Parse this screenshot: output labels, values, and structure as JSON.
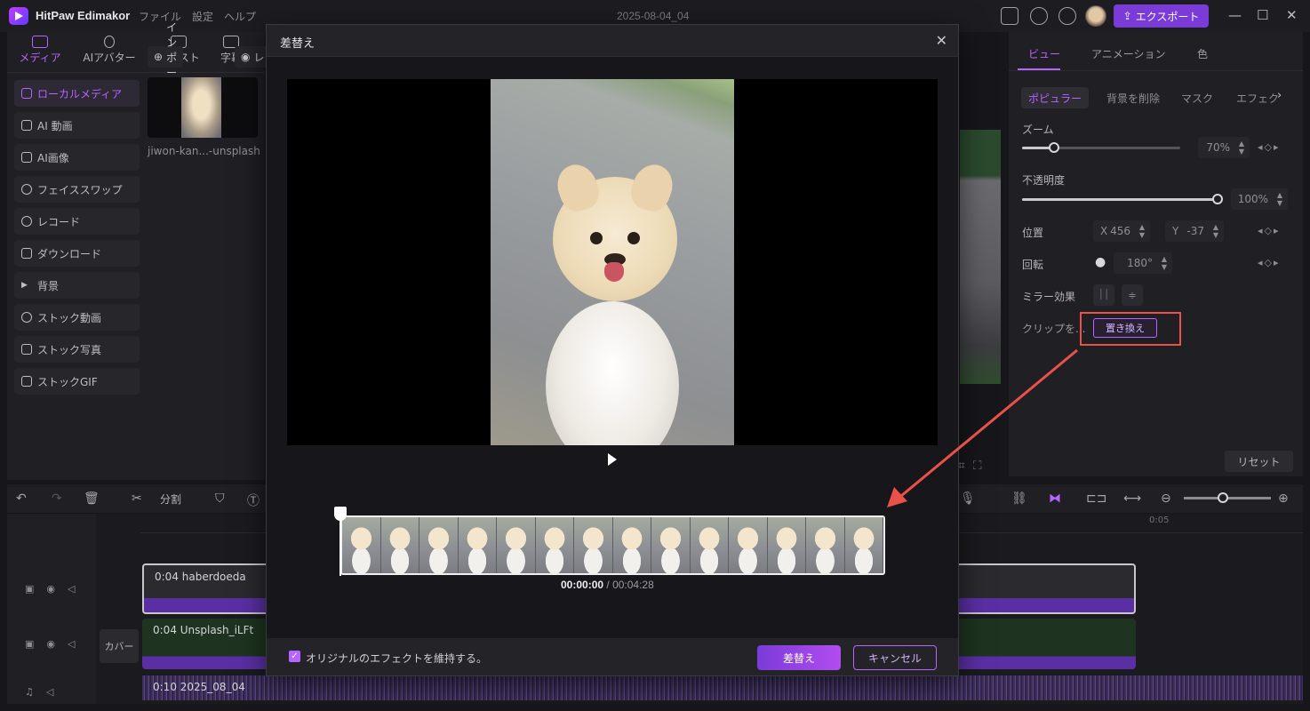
{
  "app": {
    "name": "HitPaw Edimakor",
    "menus": [
      "ファイル",
      "設定",
      "ヘルプ"
    ],
    "document_title": "2025-08-04_04",
    "export_label": "エクスポート"
  },
  "media_tabs": [
    {
      "label": "メディア",
      "icon": "media-icon",
      "active": true
    },
    {
      "label": "AIアバター",
      "icon": "avatar-icon"
    },
    {
      "label": "テキスト",
      "icon": "text-icon"
    },
    {
      "label": "字幕",
      "icon": "subtitle-icon"
    }
  ],
  "sidebar": {
    "items": [
      {
        "label": "ローカルメディア",
        "icon": "folder-icon",
        "active": true
      },
      {
        "label": "AI 動画",
        "icon": "ai-video-icon"
      },
      {
        "label": "AI画像",
        "icon": "ai-image-icon"
      },
      {
        "label": "フェイススワップ",
        "icon": "face-swap-icon"
      },
      {
        "label": "レコード",
        "icon": "record-icon"
      },
      {
        "label": "ダウンロード",
        "icon": "download-icon"
      },
      {
        "label": "背景",
        "icon": "triangle-icon"
      },
      {
        "label": "ストック動画",
        "icon": "stock-video-icon"
      },
      {
        "label": "ストック写真",
        "icon": "stock-photo-icon"
      },
      {
        "label": "ストックGIF",
        "icon": "gif-icon"
      }
    ]
  },
  "library": {
    "import_label": "インポート",
    "record_label": "レ",
    "file_name": "jiwon-kan...-unsplash"
  },
  "properties": {
    "tabs": [
      "ビュー",
      "アニメーション",
      "色"
    ],
    "sub_tabs": [
      "ポピュラー",
      "背景を削除",
      "マスク",
      "エフェク"
    ],
    "zoom_label": "ズーム",
    "zoom_value": "70%",
    "zoom_level": 0.2,
    "opacity_label": "不透明度",
    "opacity_value": "100%",
    "opacity_level": 1.0,
    "position_label": "位置",
    "pos_x_label": "X",
    "pos_x": "456",
    "pos_y_label": "Y",
    "pos_y": "-37",
    "rotation_label": "回転",
    "rotation_value": "180°",
    "mirror_label": "ミラー効果",
    "clip_label": "クリップを...",
    "replace_clip_label": "置き換え",
    "reset_label": "リセット"
  },
  "toolbar": {
    "split_label": "分割"
  },
  "timeline": {
    "ruler_mark": "0:05",
    "clip_a_label": "0:04  haberdoeda",
    "clip_b_label": "0:04  Unsplash_iLFt",
    "cover_label": "カバー",
    "audio_label": "0:10  2025_08_04"
  },
  "modal": {
    "title": "差替え",
    "timecode_current": "00:00:00",
    "timecode_separator": " / ",
    "timecode_total": "00:04:28",
    "keep_effects_label": "オリジナルのエフェクトを維持する。",
    "keep_effects_checked": true,
    "replace_label": "差替え",
    "cancel_label": "キャンセル"
  },
  "colors": {
    "accent": "#b864ff",
    "primary_button": "#7a3bd8",
    "annotation": "#e9514a"
  }
}
